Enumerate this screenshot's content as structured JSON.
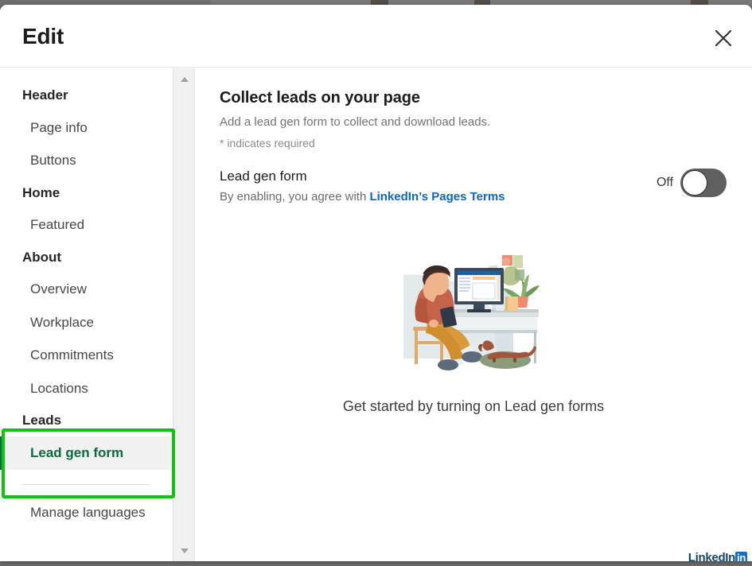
{
  "modal": {
    "title": "Edit",
    "close_icon": "close-icon"
  },
  "sidebar": {
    "items": [
      {
        "label": "Header",
        "type": "group"
      },
      {
        "label": "Page info",
        "type": "item"
      },
      {
        "label": "Buttons",
        "type": "item"
      },
      {
        "label": "Home",
        "type": "group"
      },
      {
        "label": "Featured",
        "type": "item"
      },
      {
        "label": "About",
        "type": "group"
      },
      {
        "label": "Overview",
        "type": "item"
      },
      {
        "label": "Workplace",
        "type": "item"
      },
      {
        "label": "Commitments",
        "type": "item"
      },
      {
        "label": "Locations",
        "type": "item"
      },
      {
        "label": "Leads",
        "type": "group"
      },
      {
        "label": "Lead gen form",
        "type": "item",
        "selected": true
      },
      {
        "label": "Manage languages",
        "type": "item"
      }
    ],
    "scrollbar": {
      "up_icon": "scroll-up-arrow-icon",
      "down_icon": "scroll-down-arrow-icon"
    },
    "annotation_color": "#12c212",
    "selected_color": "#0a6b3d"
  },
  "main": {
    "title": "Collect leads on your page",
    "subtitle": "Add a lead gen form to collect and download leads.",
    "required_note": "* indicates required",
    "toggle": {
      "label": "Lead gen form",
      "help_prefix": "By enabling, you agree with ",
      "help_link": "LinkedIn’s Pages Terms",
      "state_label": "Off",
      "checked": false
    },
    "empty_state": {
      "illustration": "person-at-desk-with-dog-illustration",
      "caption": "Get started by turning on Lead gen forms"
    }
  },
  "watermark": {
    "text": "LinkedIn",
    "badge": "in"
  },
  "colors": {
    "link": "#0a66c2",
    "accent_green": "#0a6b3d",
    "annotation_green": "#12c212",
    "toggle_off_track": "#5f5f5f"
  }
}
